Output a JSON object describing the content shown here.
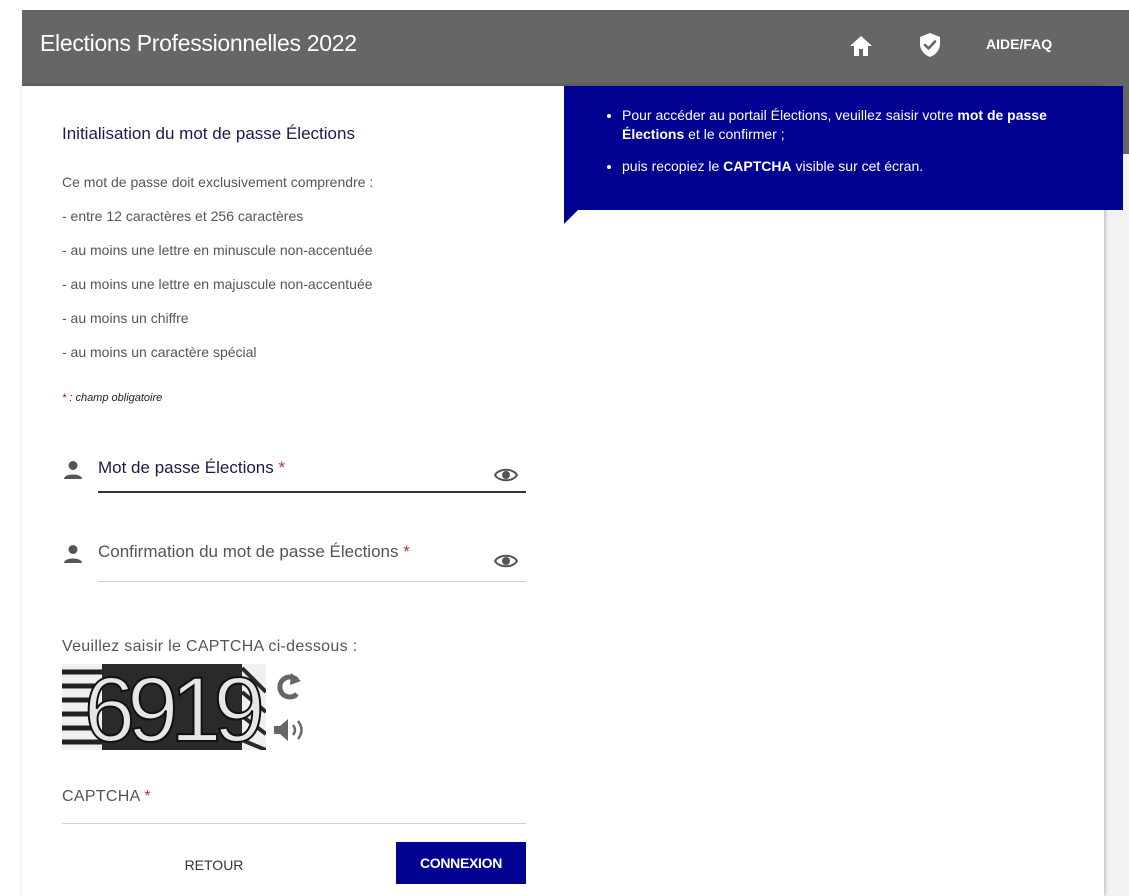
{
  "header": {
    "title": "Elections Professionnelles 2022",
    "faq_label": "AIDE/FAQ",
    "icons": [
      "home-icon",
      "shield-check-icon"
    ]
  },
  "info": {
    "item1_pre": "Pour accéder au portail Élections, veuillez saisir votre ",
    "item1_bold": "mot de passe Élections",
    "item1_post": " et le confirmer ;",
    "item2_pre": "puis recopiez le ",
    "item2_bold": "CAPTCHA",
    "item2_post": " visible sur cet écran."
  },
  "form": {
    "title": "Initialisation du mot de passe Élections",
    "rules": [
      "Ce mot de passe doit exclusivement comprendre :",
      "- entre 12 caractères et 256 caractères",
      "- au moins une lettre en minuscule non-accentuée",
      "- au moins une lettre en majuscule non-accentuée",
      "- au moins un chiffre",
      "- au moins un caractère spécial"
    ],
    "required_star": "*",
    "required_note": " : champ obligatoire",
    "password_label": "Mot de passe Élections",
    "confirm_label": "Confirmation du mot de passe Élections",
    "captcha_prompt": "Veuillez saisir le CAPTCHA ci-dessous :",
    "captcha_text": "6919",
    "captcha_field_label": "CAPTCHA",
    "star": "*"
  },
  "buttons": {
    "back": "RETOUR",
    "connect": "CONNEXION"
  },
  "colors": {
    "header_bg": "#666666",
    "accent_blue": "#000091",
    "required_red": "#c03030"
  }
}
